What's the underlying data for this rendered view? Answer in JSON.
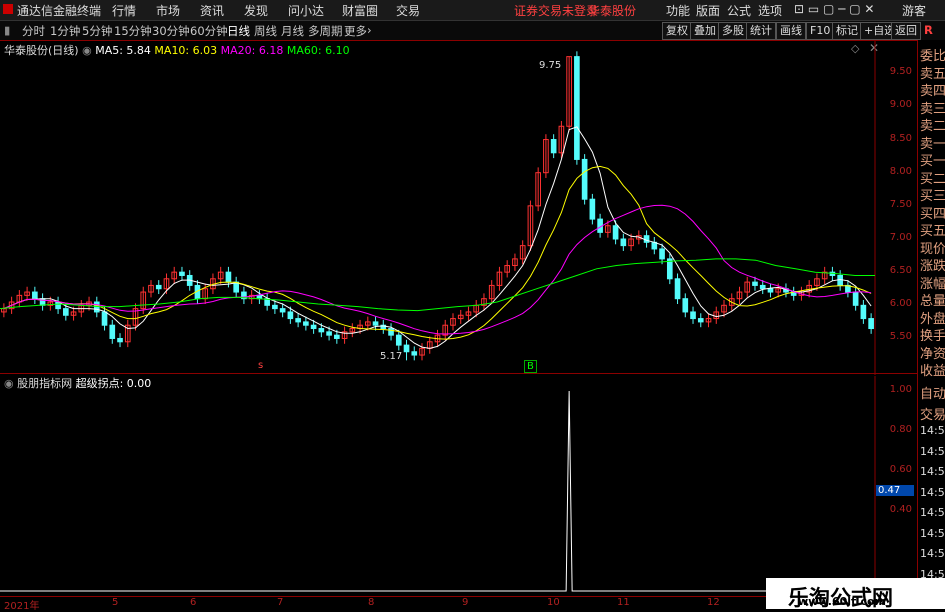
{
  "menubar": {
    "app_title": "通达信金融终端",
    "items": [
      "行情",
      "市场",
      "资讯",
      "发现",
      "问小达",
      "财富圈",
      "交易"
    ],
    "notice": "证券交易未登录",
    "stock_name": "华泰股份",
    "right_items": [
      "功能",
      "版面",
      "公式",
      "选项"
    ],
    "user": "游客"
  },
  "periodbar": {
    "periods": [
      "分时",
      "1分钟",
      "5分钟",
      "15分钟",
      "30分钟",
      "60分钟",
      "日线",
      "周线",
      "月线",
      "多周期",
      "更多"
    ],
    "active": "日线",
    "right_buttons": [
      "复权",
      "叠加",
      "多股",
      "统计",
      "画线",
      "F10",
      "标记",
      "+自选",
      "返回"
    ],
    "r_label": "R"
  },
  "chart_info": {
    "title": "华泰股份(日线)",
    "ma5": "MA5: 5.84",
    "ma10": "MA10: 6.03",
    "ma20": "MA20: 6.18",
    "ma60": "MA60: 6.10",
    "colors": {
      "ma5": "#ffffff",
      "ma10": "#ffff00",
      "ma20": "#ff00ff",
      "ma60": "#00ff00"
    }
  },
  "price_axis": [
    "9.50",
    "9.00",
    "8.50",
    "8.00",
    "7.50",
    "7.00",
    "6.50",
    "6.00",
    "5.50"
  ],
  "annotations": {
    "high": "9.75",
    "low": "5.17",
    "marker_s": "s",
    "marker_b": "B"
  },
  "indicator": {
    "name": "股朋指标网",
    "line": "超级拐点: 0.00",
    "axis": [
      "1.00",
      "0.80",
      "0.60",
      "0.40"
    ],
    "current_value": "0.47"
  },
  "x_axis": [
    "2021年",
    "5",
    "6",
    "7",
    "8",
    "9",
    "10",
    "11",
    "12"
  ],
  "side_panel": {
    "top": [
      "委比",
      "卖五",
      "卖四",
      "卖三",
      "卖二",
      "卖一",
      "买一",
      "买二",
      "买三",
      "买四",
      "买五",
      "现价",
      "涨跌",
      "涨幅",
      "总量",
      "外盘",
      "换手",
      "净资",
      "收益"
    ],
    "bottom": [
      "自动",
      "交易",
      "14:56",
      "14:56",
      "14:56",
      "14:56",
      "14:56",
      "14:56",
      "14:56",
      "14:56",
      "14:56"
    ]
  },
  "watermark": {
    "line1": "乐淘公式网",
    "line2": "www.60lt.com"
  },
  "chart_data": {
    "type": "candlestick",
    "title": "华泰股份(日线)",
    "ylim": [
      5.1,
      9.85
    ],
    "closes": [
      5.95,
      6.05,
      6.15,
      6.2,
      6.1,
      6.0,
      6.05,
      5.95,
      5.85,
      5.9,
      6.0,
      6.05,
      5.9,
      5.7,
      5.5,
      5.45,
      5.7,
      5.95,
      6.2,
      6.3,
      6.25,
      6.4,
      6.5,
      6.45,
      6.3,
      6.1,
      6.25,
      6.4,
      6.5,
      6.35,
      6.2,
      6.1,
      6.15,
      6.1,
      6.0,
      5.95,
      5.9,
      5.8,
      5.75,
      5.7,
      5.65,
      5.6,
      5.55,
      5.5,
      5.6,
      5.65,
      5.7,
      5.75,
      5.7,
      5.65,
      5.55,
      5.4,
      5.3,
      5.25,
      5.35,
      5.45,
      5.55,
      5.7,
      5.8,
      5.85,
      5.9,
      6.0,
      6.1,
      6.3,
      6.5,
      6.6,
      6.7,
      6.9,
      7.5,
      8.0,
      8.5,
      8.3,
      8.7,
      9.75,
      8.2,
      7.6,
      7.3,
      7.1,
      7.2,
      7.0,
      6.9,
      7.0,
      7.05,
      6.95,
      6.85,
      6.7,
      6.4,
      6.1,
      5.9,
      5.8,
      5.75,
      5.8,
      5.9,
      6.0,
      6.1,
      6.2,
      6.35,
      6.3,
      6.25,
      6.2,
      6.25,
      6.2,
      6.15,
      6.2,
      6.3,
      6.4,
      6.5,
      6.45,
      6.3,
      6.2,
      6.0,
      5.8,
      5.65
    ],
    "ma60_curve": [
      5.95,
      5.98,
      6.0,
      6.02,
      6.0,
      5.98,
      5.98,
      6.0,
      6.02,
      6.05,
      6.1,
      6.12,
      6.12,
      6.1,
      6.08,
      6.05,
      6.02,
      6.0,
      5.98,
      5.95,
      5.93,
      5.92,
      5.95,
      5.98,
      6.0,
      6.05,
      6.15,
      6.25,
      6.35,
      6.45,
      6.55,
      6.6,
      6.63,
      6.65,
      6.67,
      6.68,
      6.7,
      6.7,
      6.68,
      6.6,
      6.55,
      6.5,
      6.48,
      6.45,
      6.45
    ],
    "indicator_spike": {
      "x_index": 73,
      "value": 1.0
    },
    "x_ticks": [
      "2021年",
      "5",
      "6",
      "7",
      "8",
      "9",
      "10",
      "11",
      "12"
    ]
  }
}
